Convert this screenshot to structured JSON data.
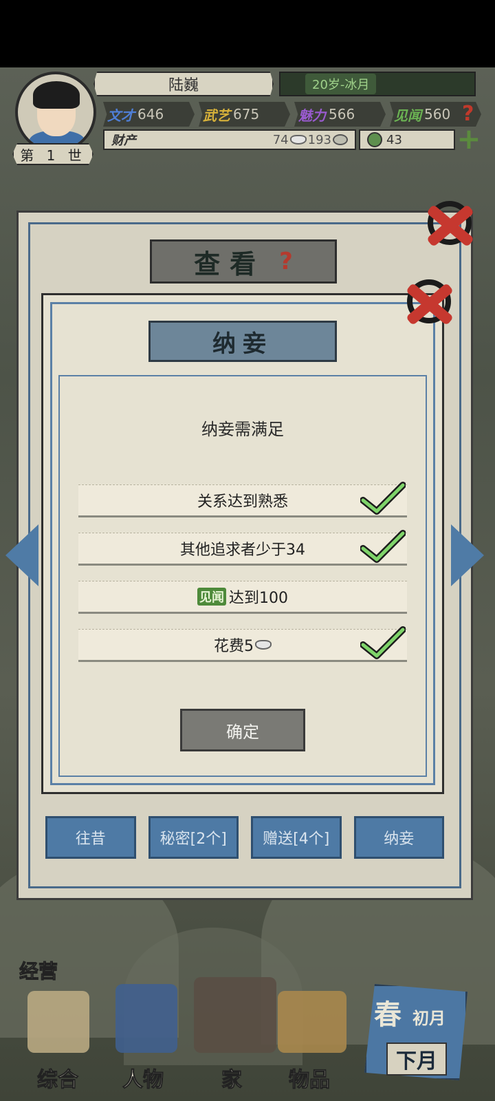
{
  "hud": {
    "name": "陆巍",
    "age_time": "20岁-冰月",
    "generation": "第 1 世",
    "stats": [
      {
        "label": "文才",
        "value": "646",
        "color": "#4f7fd6"
      },
      {
        "label": "武艺",
        "value": "675",
        "color": "#d8b23a"
      },
      {
        "label": "魅力",
        "value": "566",
        "color": "#9a5bd0"
      },
      {
        "label": "见闻",
        "value": "560",
        "color": "#6bb353"
      }
    ],
    "wealth_label": "财产",
    "wealth_coins": "74",
    "wealth_silver": "193",
    "jade_value": "43",
    "help_icon": "question-icon",
    "plus_icon": "plus-icon"
  },
  "outer_panel": {
    "title": "查看",
    "tabs": [
      "往昔",
      "秘密[2个]",
      "赠送[4个]",
      "纳妾"
    ]
  },
  "dialog": {
    "title": "纳妾",
    "subtitle": "纳妾需满足",
    "requirements": [
      {
        "prefix": "",
        "text": "关系达到熟悉",
        "met": true
      },
      {
        "prefix": "",
        "text": "其他追求者少于34",
        "met": true
      },
      {
        "prefix": "见闻",
        "text": "达到100",
        "met": false
      },
      {
        "prefix": "",
        "text": "花费5",
        "suffix_icon": "silver-ingot-icon",
        "met": true
      }
    ],
    "confirm_label": "确定"
  },
  "bottom_nav": {
    "jingying": "经营",
    "items": [
      "综合",
      "人物",
      "家",
      "物品"
    ],
    "season_big": "春",
    "season_small": "初月",
    "season_month": "下月"
  },
  "colors": {
    "accent_blue": "#4e7aa5",
    "close_red": "#c6382f",
    "check_green": "#6ec35a"
  }
}
